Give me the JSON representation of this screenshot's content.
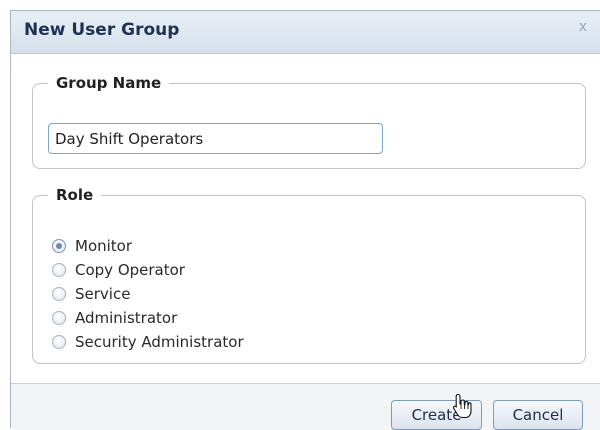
{
  "dialog": {
    "title": "New User Group",
    "close_glyph": "x"
  },
  "group_name": {
    "legend": "Group Name",
    "value": "Day Shift Operators"
  },
  "role": {
    "legend": "Role",
    "options": [
      {
        "label": "Monitor",
        "selected": true
      },
      {
        "label": "Copy Operator",
        "selected": false
      },
      {
        "label": "Service",
        "selected": false
      },
      {
        "label": "Administrator",
        "selected": false
      },
      {
        "label": "Security Administrator",
        "selected": false
      }
    ]
  },
  "buttons": {
    "create": "Create",
    "cancel": "Cancel"
  },
  "icons": {
    "close": "close-icon",
    "cursor": "hand-pointer-icon"
  }
}
